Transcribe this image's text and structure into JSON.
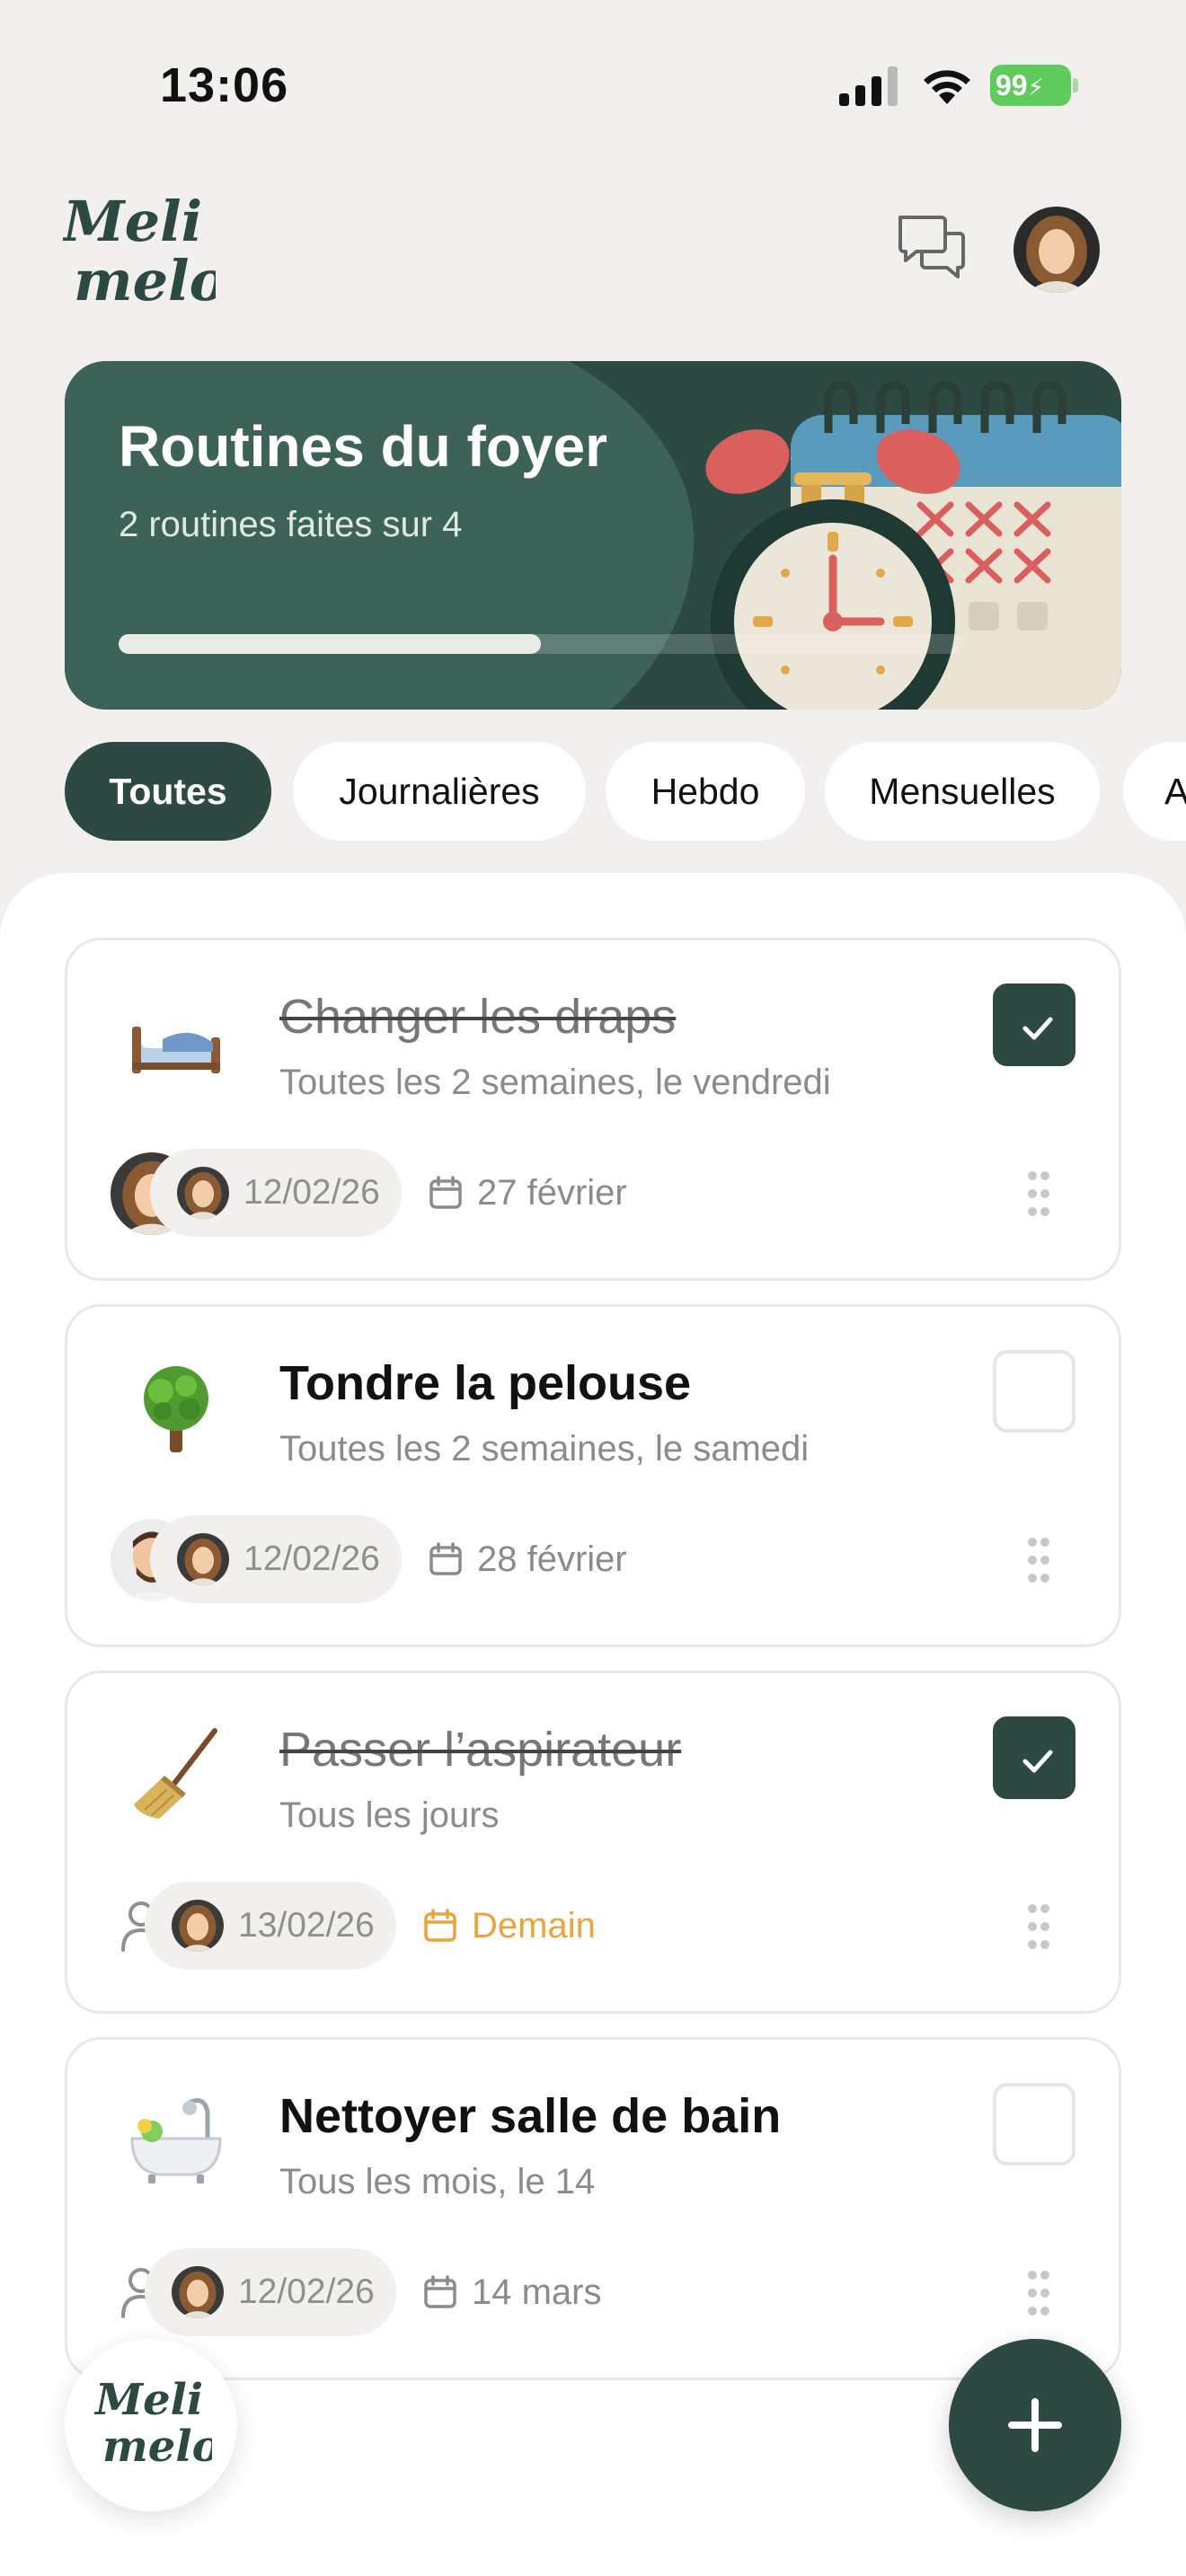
{
  "status_bar": {
    "time": "13:06",
    "battery": "99"
  },
  "header": {
    "logo_line1": "Meli",
    "logo_line2": "melo"
  },
  "hero": {
    "title": "Routines du foyer",
    "subtitle": "2 routines faites sur 4",
    "progress_fraction": 0.5
  },
  "tabs": [
    {
      "label": "Toutes",
      "active": true
    },
    {
      "label": "Journalières",
      "active": false
    },
    {
      "label": "Hebdo",
      "active": false
    },
    {
      "label": "Mensuelles",
      "active": false
    },
    {
      "label": "A",
      "active": false
    }
  ],
  "routines": [
    {
      "emoji": "bed",
      "title": "Changer les draps",
      "frequency": "Toutes les 2 semaines, le vendredi",
      "done": true,
      "assignee": "woman",
      "last_done": "12/02/26",
      "due": "27 février",
      "due_soon": false
    },
    {
      "emoji": "tree",
      "title": "Tondre la pelouse",
      "frequency": "Toutes les 2 semaines, le samedi",
      "done": false,
      "assignee": "man",
      "last_done": "12/02/26",
      "due": "28 février",
      "due_soon": false
    },
    {
      "emoji": "broom",
      "title": "Passer l’aspirateur",
      "frequency": "Tous les jours",
      "done": true,
      "assignee": "none",
      "last_done": "13/02/26",
      "due": "Demain",
      "due_soon": true
    },
    {
      "emoji": "bathtub",
      "title": "Nettoyer salle de bain",
      "frequency": "Tous les mois, le 14",
      "done": false,
      "assignee": "none",
      "last_done": "12/02/26",
      "due": "14 mars",
      "due_soon": false
    }
  ],
  "colors": {
    "brand": "#2c4a42",
    "accent_due": "#e9a43c",
    "background": "#f1f0ec"
  }
}
